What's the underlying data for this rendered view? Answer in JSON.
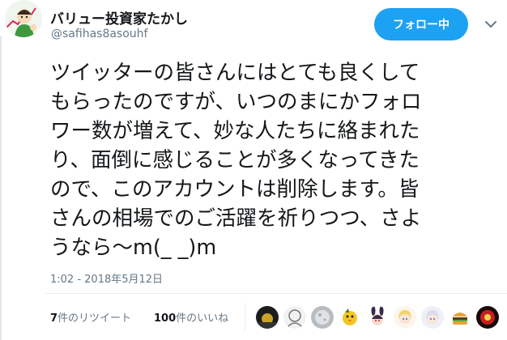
{
  "tweet": {
    "display_name": "バリュー投資家たかし",
    "handle": "@safihas8asouhf",
    "follow_label": "フォロー中",
    "text": "ツイッターの皆さんにはとても良くして\nもらったのですが、いつのまにかフォロ\nワー数が増えて、妙な人たちに絡まれた\nり、面倒に感じることが多くなってきた\nので、このアカウントは削除します。皆\nさんの相場でのご活躍を祈りつつ、さよ\nうなら〜m(_ _)m",
    "timestamp": "1:02 - 2018年5月12日"
  },
  "stats": {
    "retweet_count": "7",
    "retweet_label": "件のリツイート",
    "like_count": "100",
    "like_label": "件のいいね"
  },
  "likers": [
    {
      "icon": "liker-avatar-dark-scene"
    },
    {
      "icon": "liker-avatar-sketch"
    },
    {
      "icon": "liker-avatar-gray-moon"
    },
    {
      "icon": "liker-avatar-yellow-bird"
    },
    {
      "icon": "liker-avatar-bunny-girl"
    },
    {
      "icon": "liker-avatar-blonde-girl"
    },
    {
      "icon": "liker-avatar-white-hair"
    },
    {
      "icon": "liker-avatar-burger"
    },
    {
      "icon": "liker-avatar-red-emblem"
    }
  ],
  "colors": {
    "accent": "#1da1f2",
    "secondary_text": "#657786",
    "primary_text": "#14171a"
  }
}
